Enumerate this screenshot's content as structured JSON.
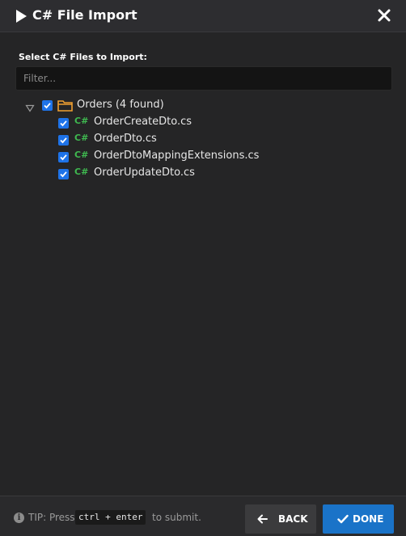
{
  "dialog": {
    "title": "C# File Import",
    "title_icon": "play-icon",
    "close_icon": "close-icon"
  },
  "form": {
    "select_label": "Select C# Files to Import:",
    "filter_placeholder": "Filter...",
    "filter_value": ""
  },
  "tree": {
    "root": {
      "label": "Orders (4 found)",
      "expanded": true,
      "checked": true,
      "icon": "folder-icon"
    },
    "files": [
      {
        "label": "OrderCreateDto.cs",
        "checked": true,
        "icon_text": "C#"
      },
      {
        "label": "OrderDto.cs",
        "checked": true,
        "icon_text": "C#"
      },
      {
        "label": "OrderDtoMappingExtensions.cs",
        "checked": true,
        "icon_text": "C#"
      },
      {
        "label": "OrderUpdateDto.cs",
        "checked": true,
        "icon_text": "C#"
      }
    ]
  },
  "footer": {
    "tip_icon": "info-icon",
    "tip_prefix": "TIP: Press",
    "tip_shortcut": "ctrl + enter",
    "tip_suffix": "to submit.",
    "back_label": "BACK",
    "done_label": "DONE"
  },
  "colors": {
    "background": "#252526",
    "accent_blue": "#1a73c8",
    "checkbox_blue": "#1e73e8",
    "csharp_green": "#3fb950",
    "folder_orange": "#f0a030"
  }
}
